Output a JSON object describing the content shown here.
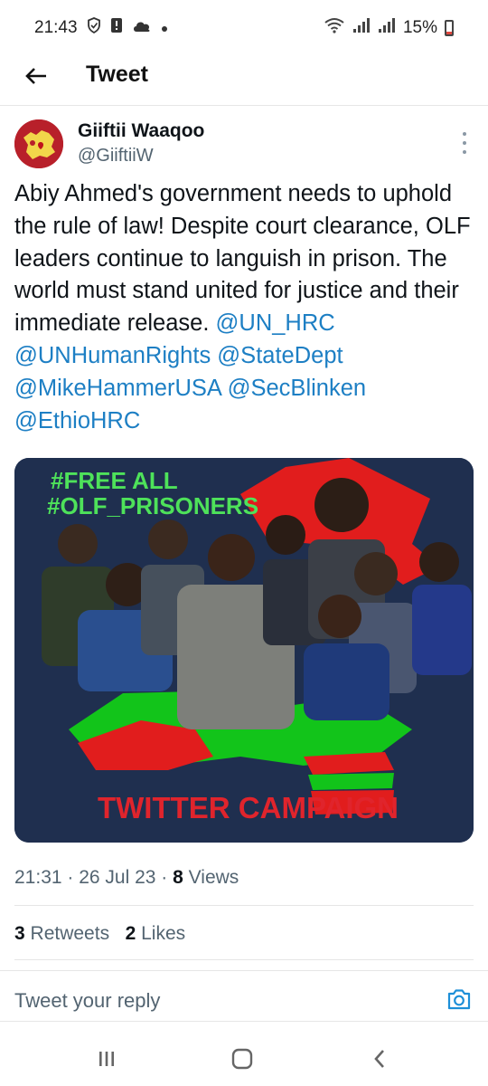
{
  "status_bar": {
    "time": "21:43",
    "battery": "15%",
    "icons": [
      "shield-icon",
      "notification-icon",
      "cloud-icon",
      "dot-icon",
      "wifi-icon",
      "signal-icon",
      "signal-icon",
      "battery-icon"
    ]
  },
  "header": {
    "title": "Tweet",
    "back_icon": "arrow-left-icon"
  },
  "tweet": {
    "author_name": "Giiftii Waaqoo",
    "author_handle": "@GiiftiiW",
    "text_plain": "Abiy Ahmed's government needs to uphold the rule of law! Despite court clearance, OLF leaders continue to languish in prison. The world must stand united for justice and their immediate release.",
    "mentions": [
      "@UN_HRC",
      "@UNHumanRights",
      "@StateDept",
      "@MikeHammerUSA",
      "@SecBlinken",
      "@EthioHRC"
    ],
    "media": {
      "headline_1": "#FREE ALL",
      "headline_2": "#OLF_PRISONERS",
      "footer_text": "TWITTER CAMPAIGN"
    },
    "time": "21:31",
    "date": "26 Jul 23",
    "views_count": "8",
    "views_label": "Views",
    "retweets_count": "3",
    "retweets_label": "Retweets",
    "likes_count": "2",
    "likes_label": "Likes"
  },
  "reply": {
    "placeholder": "Tweet your reply",
    "camera_icon": "camera-icon"
  },
  "nav_bar": {
    "icons": [
      "recent-apps-icon",
      "home-icon",
      "back-icon"
    ]
  },
  "colors": {
    "link": "#1d7fc4",
    "secondary_text": "#536471",
    "media_bg": "#1f2f4f",
    "flag_red": "#e11d1d",
    "flag_green": "#12c41a",
    "headline_green": "#4ee25a",
    "campaign_red": "#e0242c"
  }
}
